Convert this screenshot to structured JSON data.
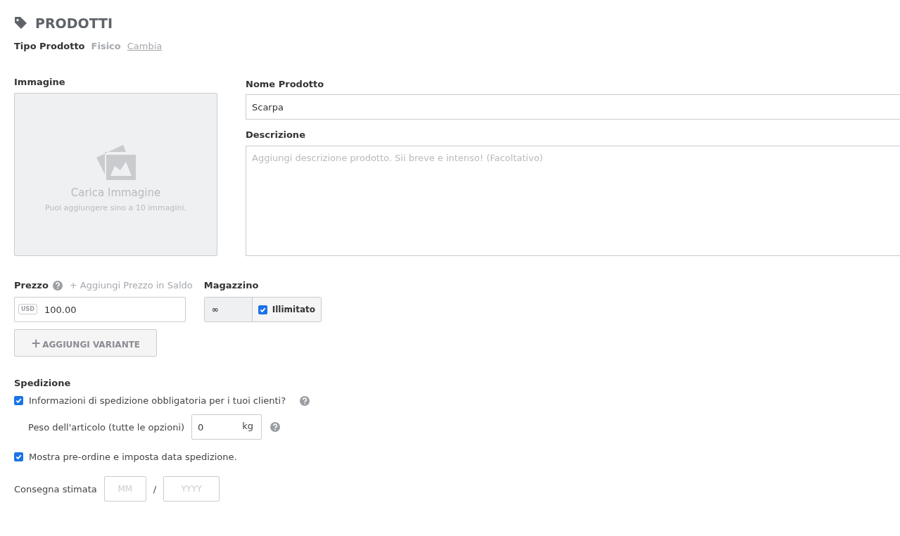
{
  "header": {
    "title": "PRODOTTI"
  },
  "product_type": {
    "label": "Tipo Prodotto",
    "value": "Fisico",
    "change_link": "Cambia"
  },
  "image": {
    "label": "Immagine",
    "title": "Carica Immagine",
    "hint": "Puoi aggiungere sino a 10 immagini."
  },
  "name": {
    "label": "Nome Prodotto",
    "value": "Scarpa"
  },
  "description": {
    "label": "Descrizione",
    "placeholder": "Aggiungi descrizione prodotto. Sii breve e intenso! (Facoltativo)"
  },
  "price": {
    "label": "Prezzo",
    "sale_link": "+ Aggiungi Prezzo in Saldo",
    "currency": "USD",
    "value": "100.00"
  },
  "stock": {
    "label": "Magazzino",
    "value": "∞",
    "unlimited_label": "Illimitato",
    "unlimited": true
  },
  "variant_button": {
    "icon": "+",
    "label": "AGGIUNGI VARIANTE"
  },
  "shipping": {
    "label": "Spedizione",
    "required": {
      "label": "Informazioni di spedizione obbligatoria per i tuoi clienti?",
      "checked": true
    },
    "weight": {
      "label": "Peso dell'articolo (tutte le opzioni)",
      "value": "0",
      "unit": "kg"
    },
    "preorder": {
      "label": "Mostra pre-ordine e imposta data spedizione.",
      "checked": true
    },
    "delivery": {
      "label": "Consegna stimata",
      "month_placeholder": "MM",
      "separator": "/",
      "year_placeholder": "YYYY"
    }
  }
}
